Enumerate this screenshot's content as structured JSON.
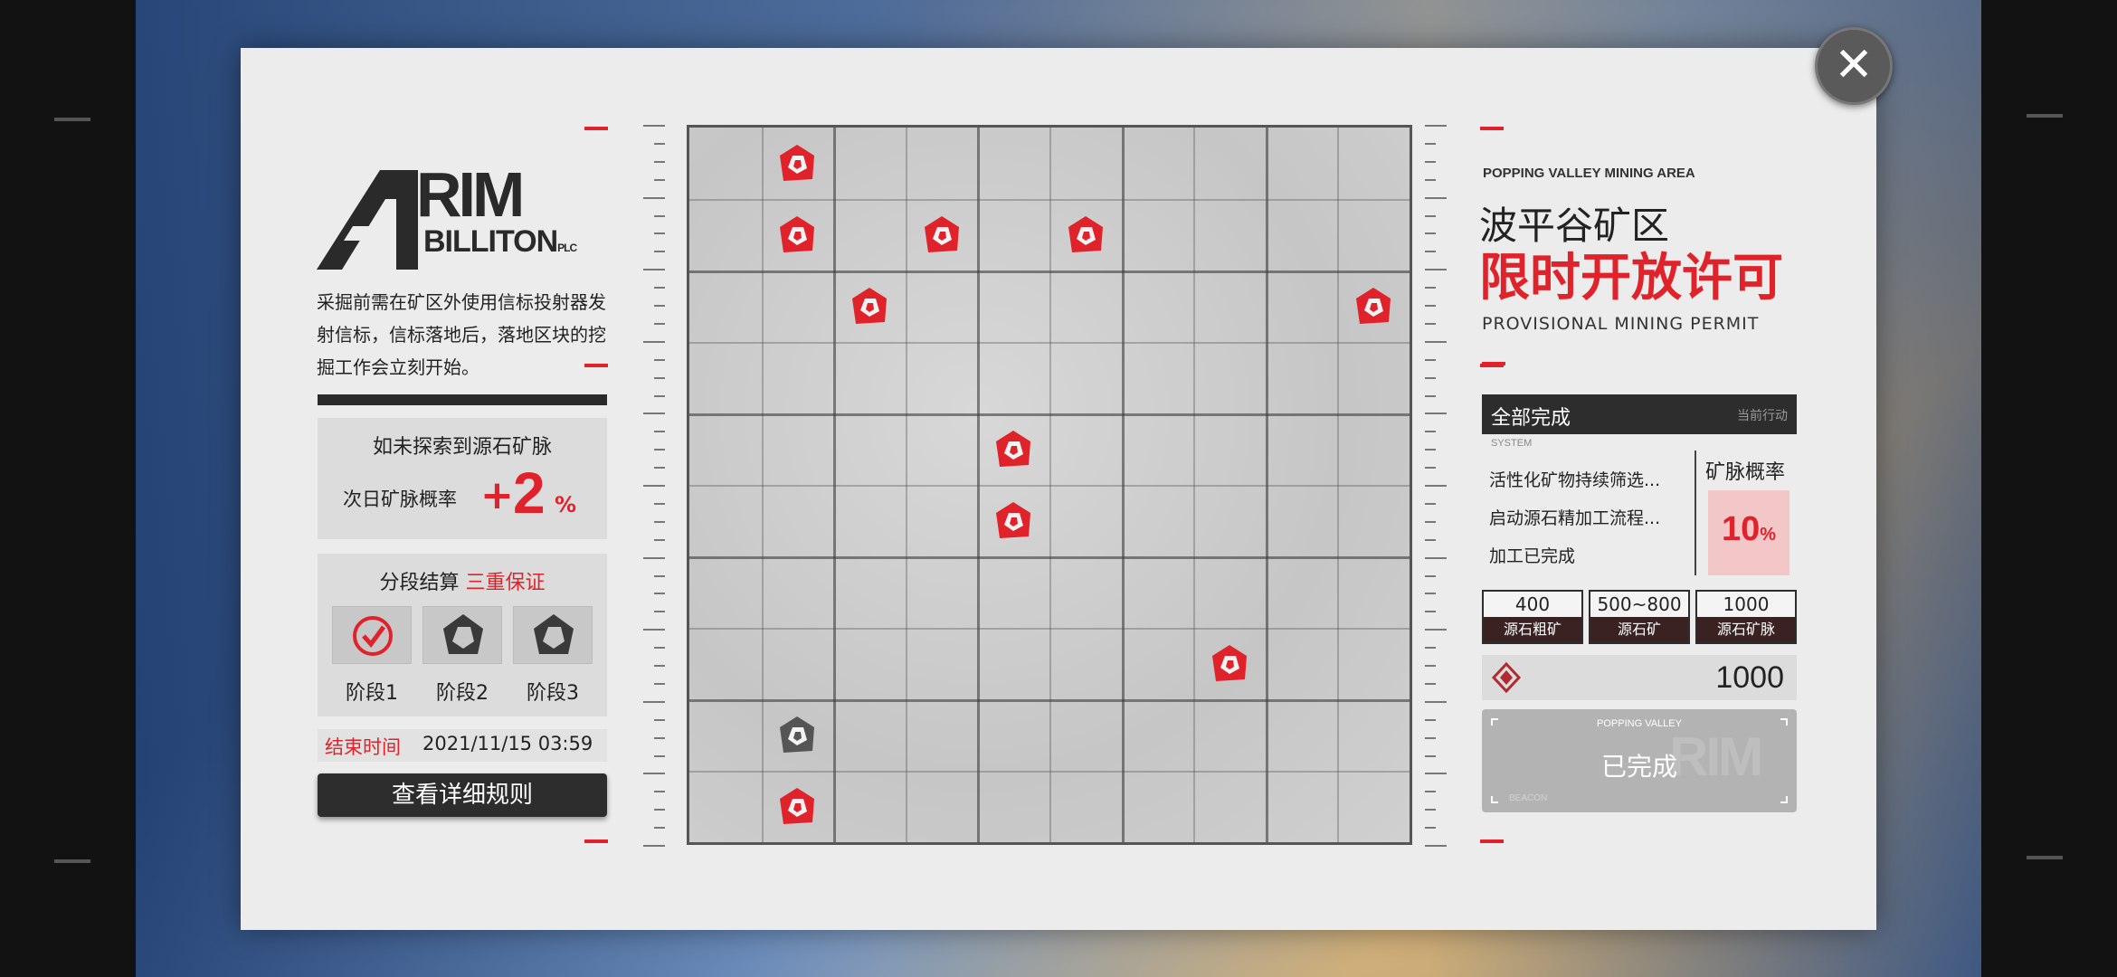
{
  "logo": {
    "line1": "RIM",
    "line2": "BILLITON",
    "suffix": "PLC"
  },
  "intro": "采掘前需在矿区外使用信标投射器发射信标，信标落地后，落地区块的挖掘工作会立刻开始。",
  "bonus": {
    "line1": "如未探索到源石矿脉",
    "line2": "次日矿脉概率",
    "plus": "+",
    "value": "2",
    "unit": "%"
  },
  "stages": {
    "title": "分段结算",
    "title_red": "三重保证",
    "items": [
      {
        "label": "阶段1",
        "icon": "check-icon",
        "state": "complete"
      },
      {
        "label": "阶段2",
        "icon": "ore-icon",
        "state": "pending"
      },
      {
        "label": "阶段3",
        "icon": "ore-icon",
        "state": "pending"
      }
    ]
  },
  "end_time": {
    "label": "结束时间",
    "value": "2021/11/15 03:59"
  },
  "rules_button": "查看详细规则",
  "map": {
    "columns": 10,
    "rows": 10,
    "markers": [
      {
        "col": 1,
        "row": 0,
        "state": "red"
      },
      {
        "col": 1,
        "row": 1,
        "state": "red"
      },
      {
        "col": 3,
        "row": 1,
        "state": "red"
      },
      {
        "col": 5,
        "row": 1,
        "state": "red"
      },
      {
        "col": 2,
        "row": 2,
        "state": "red"
      },
      {
        "col": 9,
        "row": 2,
        "state": "red"
      },
      {
        "col": 4,
        "row": 4,
        "state": "red"
      },
      {
        "col": 4,
        "row": 5,
        "state": "red"
      },
      {
        "col": 7,
        "row": 7,
        "state": "red"
      },
      {
        "col": 1,
        "row": 8,
        "state": "gray"
      },
      {
        "col": 1,
        "row": 9,
        "state": "red"
      }
    ]
  },
  "right": {
    "subtitle": "POPPING VALLEY MINING AREA",
    "title_cn": "波平谷矿区",
    "title_red": "限时开放许可",
    "title_en": "PROVISIONAL MINING PERMIT",
    "status_main": "全部完成",
    "status_sub": "当前行动",
    "system_label": "SYSTEM",
    "logs": [
      "活性化矿物持续筛选...",
      "启动源石精加工流程...",
      "加工已完成"
    ],
    "rate_label": "矿脉概率",
    "rate_value": "10",
    "rate_unit": "%",
    "tiers": [
      {
        "value": "400",
        "label": "源石粗矿"
      },
      {
        "value": "500~800",
        "label": "源石矿"
      },
      {
        "value": "1000",
        "label": "源石矿脉"
      }
    ],
    "count": "1000",
    "card_small": "POPPING VALLEY",
    "card_main": "已完成",
    "card_wm": "RIM",
    "card_beacon": "BEACON"
  },
  "colors": {
    "accent": "#e0222a",
    "dark": "#2d2d2d",
    "panel": "#ececec"
  }
}
